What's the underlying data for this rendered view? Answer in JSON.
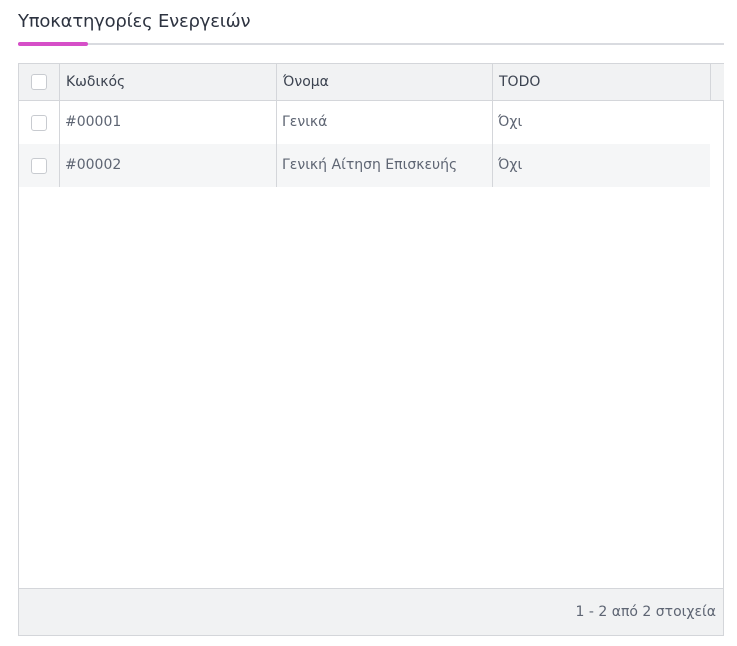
{
  "panel": {
    "title": "Υποκατηγορίες Ενεργειών",
    "accent_color": "#d64fc8"
  },
  "grid": {
    "columns": [
      {
        "key": "select",
        "label": ""
      },
      {
        "key": "code",
        "label": "Κωδικός"
      },
      {
        "key": "name",
        "label": "Όνομα"
      },
      {
        "key": "todo",
        "label": "TODO"
      }
    ],
    "rows": [
      {
        "code": "#00001",
        "name": "Γενικά",
        "todo": "Όχι"
      },
      {
        "code": "#00002",
        "name": "Γενική Αίτηση Επισκευής",
        "todo": "Όχι"
      }
    ],
    "pager_info": "1 - 2 από 2 στοιχεία"
  }
}
